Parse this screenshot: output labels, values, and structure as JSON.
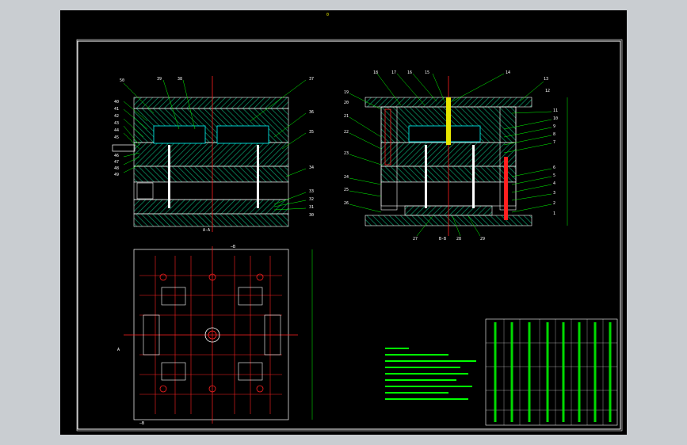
{
  "drawing": {
    "title_mark": "0",
    "section_labels": {
      "left": "A-A",
      "right": "B-B",
      "plan_top": "—B",
      "plan_bottom": "—B",
      "plan_left": "A"
    },
    "left_parts": [
      "40",
      "41",
      "42",
      "43",
      "44",
      "45",
      "46",
      "47",
      "48",
      "49",
      "50"
    ],
    "left_top_parts": [
      "39",
      "38",
      "37"
    ],
    "right_top_parts": [
      "18",
      "17",
      "16",
      "15",
      "14",
      "13",
      "12"
    ],
    "right_side_parts": [
      "11",
      "10",
      "9",
      "8",
      "7",
      "6",
      "5",
      "4",
      "3",
      "2",
      "1"
    ],
    "left_side_right_parts": [
      "36",
      "35",
      "34",
      "33",
      "32",
      "31",
      "30"
    ],
    "right_left_parts": [
      "19",
      "20",
      "21",
      "22",
      "23",
      "24",
      "25",
      "26"
    ],
    "right_bottom_parts": [
      "27",
      "28",
      "29"
    ]
  },
  "colors": {
    "border": "#ffffff",
    "hatch": "#00aa66",
    "centerline": "#ff2020",
    "leader": "#00ff00",
    "text": "#e6e600",
    "cavity": "#00ffff"
  }
}
